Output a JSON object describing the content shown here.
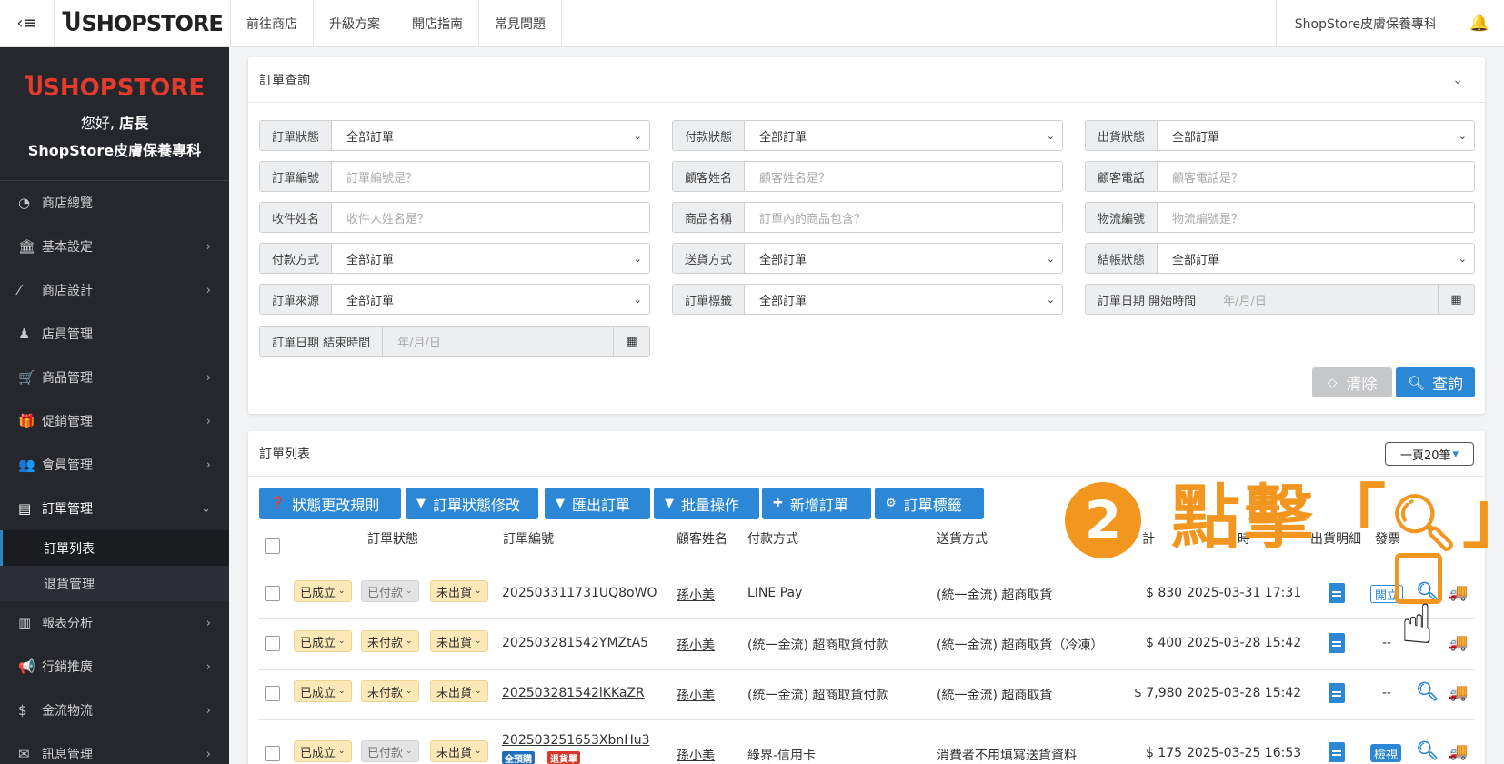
{
  "topbar": {
    "brand": "SHOPSTORE",
    "nav": [
      "前往商店",
      "升級方案",
      "開店指南",
      "常見問題"
    ],
    "store_name": "ShopStore皮膚保養專科"
  },
  "sidebar": {
    "logo": "SHOPSTORE",
    "greeting_prefix": "您好,",
    "greeting_name": "店長",
    "store_name": "ShopStore皮膚保養專科",
    "items": [
      {
        "label": "商店總覽",
        "icon": "dashboard-icon"
      },
      {
        "label": "基本設定",
        "icon": "bank-icon"
      },
      {
        "label": "商店設計",
        "icon": "magic-wand-icon"
      },
      {
        "label": "店員管理",
        "icon": "user-tie-icon"
      },
      {
        "label": "商品管理",
        "icon": "cart-icon"
      },
      {
        "label": "促銷管理",
        "icon": "gift-icon"
      },
      {
        "label": "會員管理",
        "icon": "users-icon"
      },
      {
        "label": "訂單管理",
        "icon": "order-icon"
      },
      {
        "label": "報表分析",
        "icon": "bar-chart-icon"
      },
      {
        "label": "行銷推廣",
        "icon": "bullhorn-icon"
      },
      {
        "label": "金流物流",
        "icon": "dollar-icon"
      },
      {
        "label": "訊息管理",
        "icon": "message-icon"
      }
    ],
    "sub_items": [
      "訂單列表",
      "退貨管理"
    ]
  },
  "query": {
    "title": "訂單查詢",
    "fields": [
      {
        "label": "訂單狀態",
        "value": "全部訂單",
        "type": "select"
      },
      {
        "label": "付款狀態",
        "value": "全部訂單",
        "type": "select"
      },
      {
        "label": "出貨狀態",
        "value": "全部訂單",
        "type": "select"
      },
      {
        "label": "訂單編號",
        "value": "訂單編號是？",
        "type": "input"
      },
      {
        "label": "顧客姓名",
        "value": "顧客姓名是？",
        "type": "input"
      },
      {
        "label": "顧客電話",
        "value": "顧客電話是？",
        "type": "input"
      },
      {
        "label": "收件姓名",
        "value": "收件人姓名是？",
        "type": "input"
      },
      {
        "label": "商品名稱",
        "value": "訂單內的商品包含？",
        "type": "input"
      },
      {
        "label": "物流編號",
        "value": "物流編號是？",
        "type": "input"
      },
      {
        "label": "付款方式",
        "value": "全部訂單",
        "type": "select"
      },
      {
        "label": "送貨方式",
        "value": "全部訂單",
        "type": "select"
      },
      {
        "label": "結帳狀態",
        "value": "全部訂單",
        "type": "select"
      },
      {
        "label": "訂單來源",
        "value": "全部訂單",
        "type": "select"
      },
      {
        "label": "訂單標籤",
        "value": "全部訂單",
        "type": "select"
      },
      {
        "label": "訂單日期 開始時間",
        "value": "年/月/日",
        "type": "date"
      },
      {
        "label": "訂單日期 結束時間",
        "value": "年/月/日",
        "type": "date"
      }
    ],
    "clear_label": "清除",
    "query_label": "查詢"
  },
  "orders": {
    "title": "訂單列表",
    "per_page": "一頁20筆",
    "toolbar": [
      "狀態更改規則",
      "訂單狀態修改",
      "匯出訂單",
      "批量操作",
      "新增訂單",
      "訂單標籤"
    ],
    "columns": [
      "訂單狀態",
      "訂單編號",
      "顧客姓名",
      "付款方式",
      "送貨方式",
      "計",
      "時",
      "出貨明細",
      "發票"
    ],
    "rows": [
      {
        "status": [
          "已成立",
          "已付款",
          "未出貨"
        ],
        "id": "202503311731UQ8oWO",
        "customer": "孫小美",
        "payment": "LINE Pay",
        "shipping": "(統一金流) 超商取貨",
        "amount": "$ 830",
        "date": "2025-03-31 17:31",
        "invoice": "開立"
      },
      {
        "status": [
          "已成立",
          "未付款",
          "未出貨"
        ],
        "id": "202503281542YMZtA5",
        "customer": "孫小美",
        "payment": "(統一金流) 超商取貨付款",
        "shipping": "(統一金流) 超商取貨（冷凍）",
        "amount": "$ 400",
        "date": "2025-03-28 15:42",
        "invoice": "--"
      },
      {
        "status": [
          "已成立",
          "未付款",
          "未出貨"
        ],
        "id": "202503281542lKKaZR",
        "customer": "孫小美",
        "payment": "(統一金流) 超商取貨付款",
        "shipping": "(統一金流) 超商取貨",
        "amount": "$ 7,980",
        "date": "2025-03-28 15:42",
        "invoice": "--"
      },
      {
        "status": [
          "已成立",
          "已付款",
          "未出貨"
        ],
        "id": "202503251653XbnHu3",
        "badges": [
          "全預購",
          "退貨單"
        ],
        "customer": "孫小美",
        "payment": "綠界-信用卡",
        "shipping": "消費者不用填寫送貨資料",
        "amount": "$ 175",
        "date": "2025-03-25 16:53",
        "invoice": "檢視"
      }
    ]
  },
  "annotation": {
    "step": "2",
    "text": "點擊「",
    "text_end": "」"
  },
  "colors": {
    "accent": "#2c88d6",
    "highlight": "#f2961f",
    "sidebar": "#25272d",
    "brand_red": "#e53b2c"
  }
}
